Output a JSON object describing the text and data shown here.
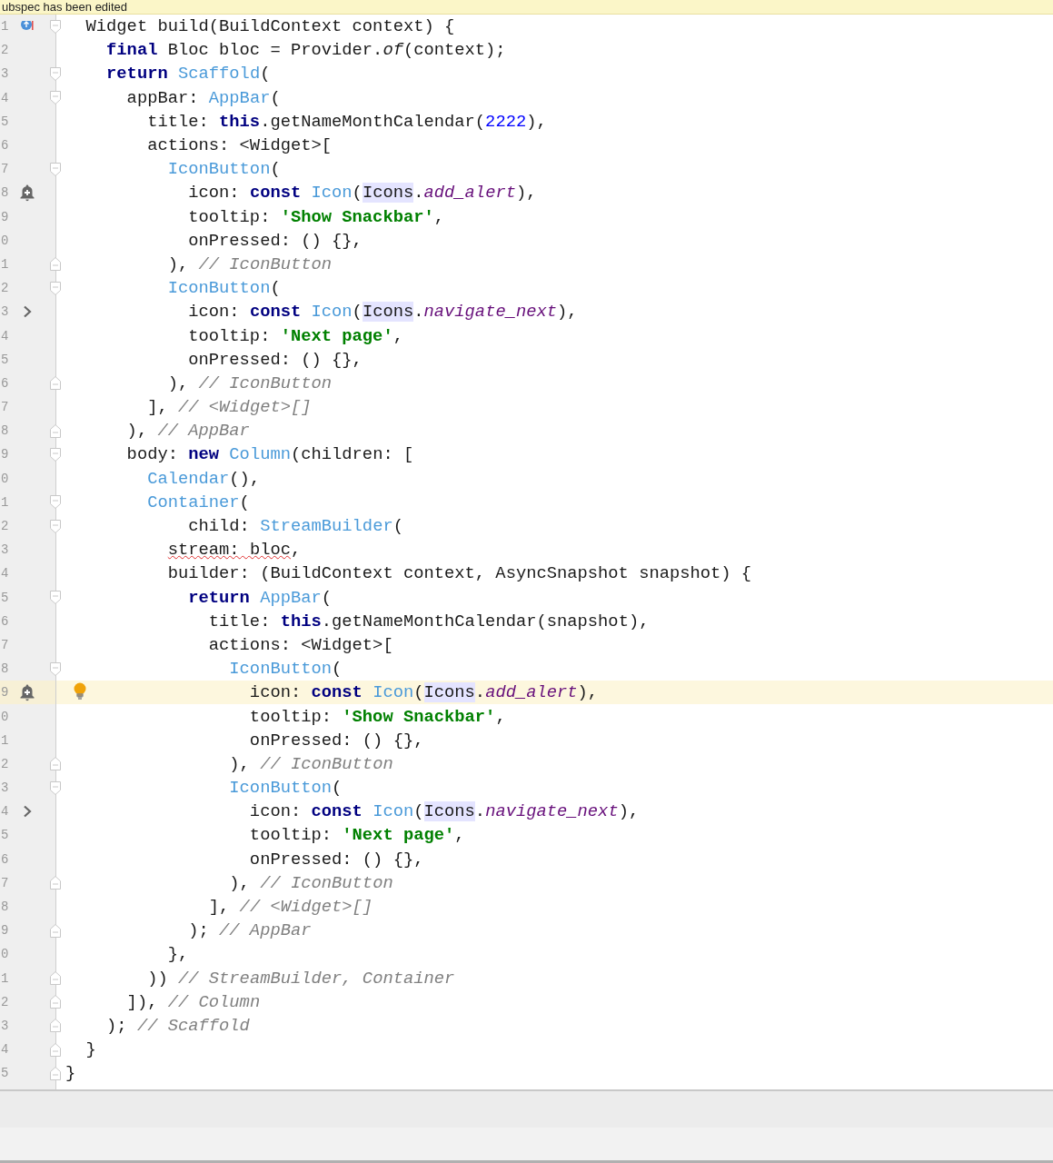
{
  "banner": {
    "text": "ubspec has been edited"
  },
  "lines": [
    {
      "number": "1",
      "current": false,
      "gutter_icon": {
        "kind": "override"
      },
      "fold": {
        "kind": "start"
      },
      "tokens": [
        {
          "kind": "plain",
          "text": "  Widget build(BuildContext context) {"
        }
      ]
    },
    {
      "number": "2",
      "current": false,
      "tokens": [
        {
          "kind": "keyword",
          "text": "    final"
        },
        {
          "kind": "plain",
          "text": " Bloc bloc = Provider."
        },
        {
          "kind": "method",
          "text": "of"
        },
        {
          "kind": "plain",
          "text": "(context);"
        }
      ]
    },
    {
      "number": "3",
      "current": false,
      "fold": {
        "kind": "start"
      },
      "tokens": [
        {
          "kind": "keyword",
          "text": "    return "
        },
        {
          "kind": "class",
          "text": "Scaffold"
        },
        {
          "kind": "plain",
          "text": "("
        }
      ]
    },
    {
      "number": "4",
      "current": false,
      "fold": {
        "kind": "start"
      },
      "tokens": [
        {
          "kind": "plain",
          "text": "      appBar: "
        },
        {
          "kind": "class",
          "text": "AppBar"
        },
        {
          "kind": "plain",
          "text": "("
        }
      ]
    },
    {
      "number": "5",
      "current": false,
      "tokens": [
        {
          "kind": "plain",
          "text": "        title: "
        },
        {
          "kind": "keyword",
          "text": "this"
        },
        {
          "kind": "plain",
          "text": ".getNameMonthCalendar("
        },
        {
          "kind": "number",
          "text": "2222"
        },
        {
          "kind": "plain",
          "text": "),"
        }
      ]
    },
    {
      "number": "6",
      "current": false,
      "tokens": [
        {
          "kind": "plain",
          "text": "        actions: <Widget>["
        }
      ]
    },
    {
      "number": "7",
      "current": false,
      "fold": {
        "kind": "start"
      },
      "tokens": [
        {
          "kind": "class",
          "text": "          IconButton"
        },
        {
          "kind": "plain",
          "text": "("
        }
      ]
    },
    {
      "number": "8",
      "current": false,
      "gutter_icon": {
        "kind": "bell"
      },
      "tokens": [
        {
          "kind": "plain",
          "text": "            icon: "
        },
        {
          "kind": "keyword",
          "text": "const "
        },
        {
          "kind": "class",
          "text": "Icon"
        },
        {
          "kind": "plain",
          "text": "("
        },
        {
          "kind": "reference",
          "text": "Icons"
        },
        {
          "kind": "plain",
          "text": "."
        },
        {
          "kind": "field",
          "text": "add_alert"
        },
        {
          "kind": "plain",
          "text": "),"
        }
      ]
    },
    {
      "number": "9",
      "current": false,
      "tokens": [
        {
          "kind": "plain",
          "text": "            tooltip: "
        },
        {
          "kind": "string",
          "text": "'Show Snackbar'"
        },
        {
          "kind": "plain",
          "text": ","
        }
      ]
    },
    {
      "number": "0",
      "current": false,
      "tokens": [
        {
          "kind": "plain",
          "text": "            onPressed: () {},"
        }
      ]
    },
    {
      "number": "1",
      "current": false,
      "fold": {
        "kind": "end"
      },
      "tokens": [
        {
          "kind": "plain",
          "text": "          ), "
        },
        {
          "kind": "comment",
          "text": "// IconButton"
        }
      ]
    },
    {
      "number": "2",
      "current": false,
      "fold": {
        "kind": "start"
      },
      "tokens": [
        {
          "kind": "class",
          "text": "          IconButton"
        },
        {
          "kind": "plain",
          "text": "("
        }
      ]
    },
    {
      "number": "3",
      "current": false,
      "gutter_icon": {
        "kind": "chevron"
      },
      "tokens": [
        {
          "kind": "plain",
          "text": "            icon: "
        },
        {
          "kind": "keyword",
          "text": "const "
        },
        {
          "kind": "class",
          "text": "Icon"
        },
        {
          "kind": "plain",
          "text": "("
        },
        {
          "kind": "reference",
          "text": "Icons"
        },
        {
          "kind": "plain",
          "text": "."
        },
        {
          "kind": "field",
          "text": "navigate_next"
        },
        {
          "kind": "plain",
          "text": "),"
        }
      ]
    },
    {
      "number": "4",
      "current": false,
      "tokens": [
        {
          "kind": "plain",
          "text": "            tooltip: "
        },
        {
          "kind": "string",
          "text": "'Next page'"
        },
        {
          "kind": "plain",
          "text": ","
        }
      ]
    },
    {
      "number": "5",
      "current": false,
      "tokens": [
        {
          "kind": "plain",
          "text": "            onPressed: () {},"
        }
      ]
    },
    {
      "number": "6",
      "current": false,
      "fold": {
        "kind": "end"
      },
      "tokens": [
        {
          "kind": "plain",
          "text": "          ), "
        },
        {
          "kind": "comment",
          "text": "// IconButton"
        }
      ]
    },
    {
      "number": "7",
      "current": false,
      "tokens": [
        {
          "kind": "plain",
          "text": "        ], "
        },
        {
          "kind": "comment",
          "text": "// <Widget>[]"
        }
      ]
    },
    {
      "number": "8",
      "current": false,
      "fold": {
        "kind": "end"
      },
      "tokens": [
        {
          "kind": "plain",
          "text": "      ), "
        },
        {
          "kind": "comment",
          "text": "// AppBar"
        }
      ]
    },
    {
      "number": "9",
      "current": false,
      "fold": {
        "kind": "start"
      },
      "tokens": [
        {
          "kind": "plain",
          "text": "      body: "
        },
        {
          "kind": "keyword",
          "text": "new "
        },
        {
          "kind": "class",
          "text": "Column"
        },
        {
          "kind": "plain",
          "text": "(children: ["
        }
      ]
    },
    {
      "number": "0",
      "current": false,
      "tokens": [
        {
          "kind": "class",
          "text": "        Calendar"
        },
        {
          "kind": "plain",
          "text": "(),"
        }
      ]
    },
    {
      "number": "1",
      "current": false,
      "fold": {
        "kind": "start"
      },
      "tokens": [
        {
          "kind": "class",
          "text": "        Container"
        },
        {
          "kind": "plain",
          "text": "("
        }
      ]
    },
    {
      "number": "2",
      "current": false,
      "fold": {
        "kind": "start"
      },
      "tokens": [
        {
          "kind": "plain",
          "text": "            child: "
        },
        {
          "kind": "class",
          "text": "StreamBuilder"
        },
        {
          "kind": "plain",
          "text": "("
        }
      ]
    },
    {
      "number": "3",
      "current": false,
      "tokens": [
        {
          "kind": "error",
          "text": "          stream: bloc"
        },
        {
          "kind": "plain",
          "text": ","
        }
      ]
    },
    {
      "number": "4",
      "current": false,
      "tokens": [
        {
          "kind": "plain",
          "text": "          builder: (BuildContext context, AsyncSnapshot snapshot) {"
        }
      ]
    },
    {
      "number": "5",
      "current": false,
      "fold": {
        "kind": "start"
      },
      "tokens": [
        {
          "kind": "keyword",
          "text": "            return "
        },
        {
          "kind": "class",
          "text": "AppBar"
        },
        {
          "kind": "plain",
          "text": "("
        }
      ]
    },
    {
      "number": "6",
      "current": false,
      "tokens": [
        {
          "kind": "plain",
          "text": "              title: "
        },
        {
          "kind": "keyword",
          "text": "this"
        },
        {
          "kind": "plain",
          "text": ".getNameMonthCalendar(snapshot),"
        }
      ]
    },
    {
      "number": "7",
      "current": false,
      "tokens": [
        {
          "kind": "plain",
          "text": "              actions: <Widget>["
        }
      ]
    },
    {
      "number": "8",
      "current": false,
      "fold": {
        "kind": "start"
      },
      "tokens": [
        {
          "kind": "class",
          "text": "                IconButton"
        },
        {
          "kind": "plain",
          "text": "("
        }
      ]
    },
    {
      "number": "9",
      "current": true,
      "gutter_icon": {
        "kind": "bell"
      },
      "line_icon": {
        "kind": "bulb"
      },
      "tokens": [
        {
          "kind": "plain",
          "text": "                  icon: "
        },
        {
          "kind": "keyword",
          "text": "const "
        },
        {
          "kind": "class",
          "text": "Icon"
        },
        {
          "kind": "plain",
          "text": "("
        },
        {
          "kind": "reference",
          "text": "Icons"
        },
        {
          "kind": "plain",
          "text": "."
        },
        {
          "kind": "field",
          "text": "add_alert"
        },
        {
          "kind": "plain",
          "text": "),"
        }
      ]
    },
    {
      "number": "0",
      "current": false,
      "tokens": [
        {
          "kind": "plain",
          "text": "                  tooltip: "
        },
        {
          "kind": "string",
          "text": "'Show Snackbar'"
        },
        {
          "kind": "plain",
          "text": ","
        }
      ]
    },
    {
      "number": "1",
      "current": false,
      "tokens": [
        {
          "kind": "plain",
          "text": "                  onPressed: () {},"
        }
      ]
    },
    {
      "number": "2",
      "current": false,
      "fold": {
        "kind": "end"
      },
      "tokens": [
        {
          "kind": "plain",
          "text": "                ), "
        },
        {
          "kind": "comment",
          "text": "// IconButton"
        }
      ]
    },
    {
      "number": "3",
      "current": false,
      "fold": {
        "kind": "start"
      },
      "tokens": [
        {
          "kind": "class",
          "text": "                IconButton"
        },
        {
          "kind": "plain",
          "text": "("
        }
      ]
    },
    {
      "number": "4",
      "current": false,
      "gutter_icon": {
        "kind": "chevron"
      },
      "tokens": [
        {
          "kind": "plain",
          "text": "                  icon: "
        },
        {
          "kind": "keyword",
          "text": "const "
        },
        {
          "kind": "class",
          "text": "Icon"
        },
        {
          "kind": "plain",
          "text": "("
        },
        {
          "kind": "reference",
          "text": "Icons"
        },
        {
          "kind": "plain",
          "text": "."
        },
        {
          "kind": "field",
          "text": "navigate_next"
        },
        {
          "kind": "plain",
          "text": "),"
        }
      ]
    },
    {
      "number": "5",
      "current": false,
      "tokens": [
        {
          "kind": "plain",
          "text": "                  tooltip: "
        },
        {
          "kind": "string",
          "text": "'Next page'"
        },
        {
          "kind": "plain",
          "text": ","
        }
      ]
    },
    {
      "number": "6",
      "current": false,
      "tokens": [
        {
          "kind": "plain",
          "text": "                  onPressed: () {},"
        }
      ]
    },
    {
      "number": "7",
      "current": false,
      "fold": {
        "kind": "end"
      },
      "tokens": [
        {
          "kind": "plain",
          "text": "                ), "
        },
        {
          "kind": "comment",
          "text": "// IconButton"
        }
      ]
    },
    {
      "number": "8",
      "current": false,
      "tokens": [
        {
          "kind": "plain",
          "text": "              ], "
        },
        {
          "kind": "comment",
          "text": "// <Widget>[]"
        }
      ]
    },
    {
      "number": "9",
      "current": false,
      "fold": {
        "kind": "end"
      },
      "tokens": [
        {
          "kind": "plain",
          "text": "            ); "
        },
        {
          "kind": "comment",
          "text": "// AppBar"
        }
      ]
    },
    {
      "number": "0",
      "current": false,
      "tokens": [
        {
          "kind": "plain",
          "text": "          },"
        }
      ]
    },
    {
      "number": "1",
      "current": false,
      "fold": {
        "kind": "end"
      },
      "tokens": [
        {
          "kind": "plain",
          "text": "        )) "
        },
        {
          "kind": "comment",
          "text": "// StreamBuilder, Container"
        }
      ]
    },
    {
      "number": "2",
      "current": false,
      "fold": {
        "kind": "end"
      },
      "tokens": [
        {
          "kind": "plain",
          "text": "      ]), "
        },
        {
          "kind": "comment",
          "text": "// Column"
        }
      ]
    },
    {
      "number": "3",
      "current": false,
      "fold": {
        "kind": "end"
      },
      "tokens": [
        {
          "kind": "plain",
          "text": "    ); "
        },
        {
          "kind": "comment",
          "text": "// Scaffold"
        }
      ]
    },
    {
      "number": "4",
      "current": false,
      "fold": {
        "kind": "end"
      },
      "tokens": [
        {
          "kind": "plain",
          "text": "  }"
        }
      ]
    },
    {
      "number": "5",
      "current": false,
      "fold": {
        "kind": "end"
      },
      "tokens": [
        {
          "kind": "plain",
          "text": "}"
        }
      ]
    }
  ]
}
